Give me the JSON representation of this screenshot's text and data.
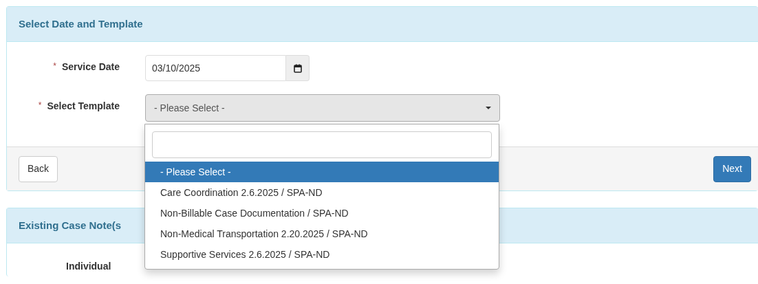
{
  "panel": {
    "title": "Select Date and Template"
  },
  "fields": [
    {
      "kind": "date",
      "label": "Service Date",
      "required_mark": "*",
      "value": "03/10/2025"
    },
    {
      "kind": "select",
      "label": "Select Template",
      "required_mark": "*",
      "value": "- Please Select -"
    }
  ],
  "dropdown": {
    "options": [
      {
        "label": "- Please Select -",
        "selected": true
      },
      {
        "label": "Care Coordination 2.6.2025 / SPA-ND",
        "selected": false
      },
      {
        "label": "Non-Billable Case Documentation / SPA-ND",
        "selected": false
      },
      {
        "label": "Non-Medical Transportation 2.20.2025 / SPA-ND",
        "selected": false
      },
      {
        "label": "Supportive Services 2.6.2025 / SPA-ND",
        "selected": false
      }
    ]
  },
  "footer": {
    "back_button": "Back",
    "next_button": "Next"
  },
  "existing_panel": {
    "title": "Existing Case Note(s",
    "field_label": "Individual"
  }
}
